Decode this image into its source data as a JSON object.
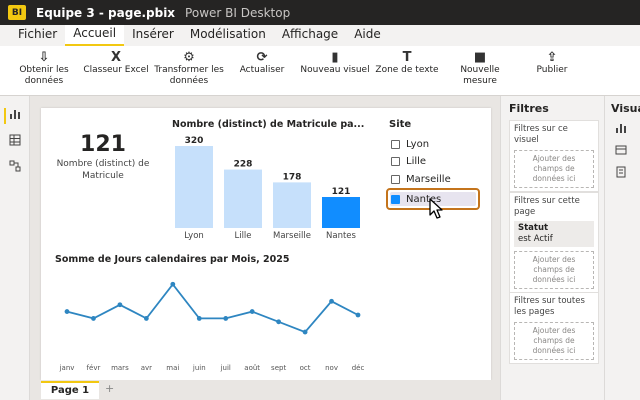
{
  "titlebar": {
    "logo": "BI",
    "title": "Equipe 3 - page.pbix",
    "app": "Power BI Desktop"
  },
  "menu": [
    "Fichier",
    "Accueil",
    "Insérer",
    "Modélisation",
    "Affichage",
    "Aide"
  ],
  "ribbon": [
    {
      "icon": "⇩",
      "label": "Obtenir les données"
    },
    {
      "icon": "X",
      "label": "Classeur Excel"
    },
    {
      "icon": "⚙",
      "label": "Transformer les données"
    },
    {
      "icon": "⟳",
      "label": "Actualiser"
    },
    {
      "icon": "▮",
      "label": "Nouveau visuel"
    },
    {
      "icon": "T",
      "label": "Zone de texte"
    },
    {
      "icon": "■",
      "label": "Nouvelle mesure"
    },
    {
      "icon": "⇪",
      "label": "Publier"
    }
  ],
  "card": {
    "value": "121",
    "label": "Nombre (distinct) de Matricule"
  },
  "slicer": {
    "title": "Site",
    "items": [
      "Lyon",
      "Lille",
      "Marseille",
      "Nantes"
    ],
    "selected": "Nantes"
  },
  "filters": {
    "title": "Filtres",
    "visual_header": "Filtres sur ce visuel",
    "page_header": "Filtres sur cette page",
    "all_header": "Filtres sur toutes les pages",
    "drop": "Ajouter des champs de données ici",
    "status_field": "Statut",
    "status_value": "est Actif"
  },
  "visuals_pane": {
    "title": "Visualisations"
  },
  "pages": {
    "tab": "Page 1",
    "add": "+"
  },
  "chart_data": [
    {
      "type": "bar",
      "title": "Nombre (distinct) de Matricule pa...",
      "categories": [
        "Lyon",
        "Lille",
        "Marseille",
        "Nantes"
      ],
      "values": [
        320,
        228,
        178,
        121
      ],
      "highlighted": "Nantes",
      "colors": {
        "bar": "#c6e0fb",
        "highlight": "#118dff"
      },
      "ylim": [
        0,
        320
      ]
    },
    {
      "type": "line",
      "title": "Somme de Jours calendaires par Mois, 2025",
      "categories": [
        "janv",
        "févr",
        "mars",
        "avr",
        "mai",
        "juin",
        "juil",
        "août",
        "sept",
        "oct",
        "nov",
        "déc"
      ],
      "values": [
        13,
        11,
        15,
        11,
        21,
        11,
        11,
        13,
        10,
        7,
        16,
        12
      ],
      "ylim": [
        0,
        24
      ],
      "color": "#2e86c1"
    }
  ]
}
